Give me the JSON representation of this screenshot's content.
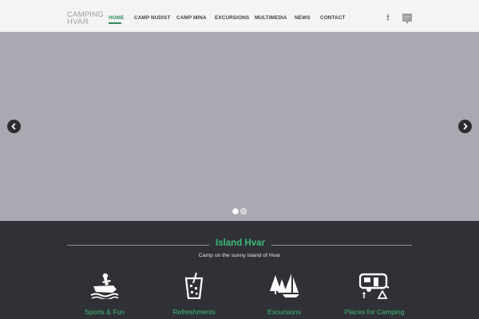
{
  "header": {
    "logo_line1": "CAMPING",
    "logo_line2": "HVAR",
    "nav": [
      {
        "label": "HOME"
      },
      {
        "label": "CAMP NUDIST"
      },
      {
        "label": "CAMP MINA"
      },
      {
        "label": "EXCURSIONS"
      },
      {
        "label": "MULTIMEDIA"
      },
      {
        "label": "NEWS"
      },
      {
        "label": "CONTACT"
      }
    ],
    "active_nav": "HOME",
    "facebook_glyph": "f",
    "icons": [
      "facebook-icon",
      "chat-bubble-icon"
    ]
  },
  "slider": {
    "background_color": "#a9a9b1",
    "slide_count": 2,
    "active_slide": 1,
    "icons": [
      "arrow-left-icon",
      "arrow-right-icon"
    ]
  },
  "section": {
    "title": "Island Hvar",
    "subtitle": "Camp on the sunny island of Hvar",
    "features": [
      {
        "label": "Sports & Fun",
        "icon": "jet-ski-icon"
      },
      {
        "label": "Refreshments",
        "icon": "drink-glass-icon"
      },
      {
        "label": "Excursions",
        "icon": "trees-sailboat-icon"
      },
      {
        "label": "Places for Camping",
        "icon": "caravan-camping-icon"
      }
    ]
  },
  "colors": {
    "accent": "#3cbc78",
    "nav_active": "#2f8a5c",
    "dark_bg": "#2f3136",
    "header_bg": "#f4f4f4"
  }
}
